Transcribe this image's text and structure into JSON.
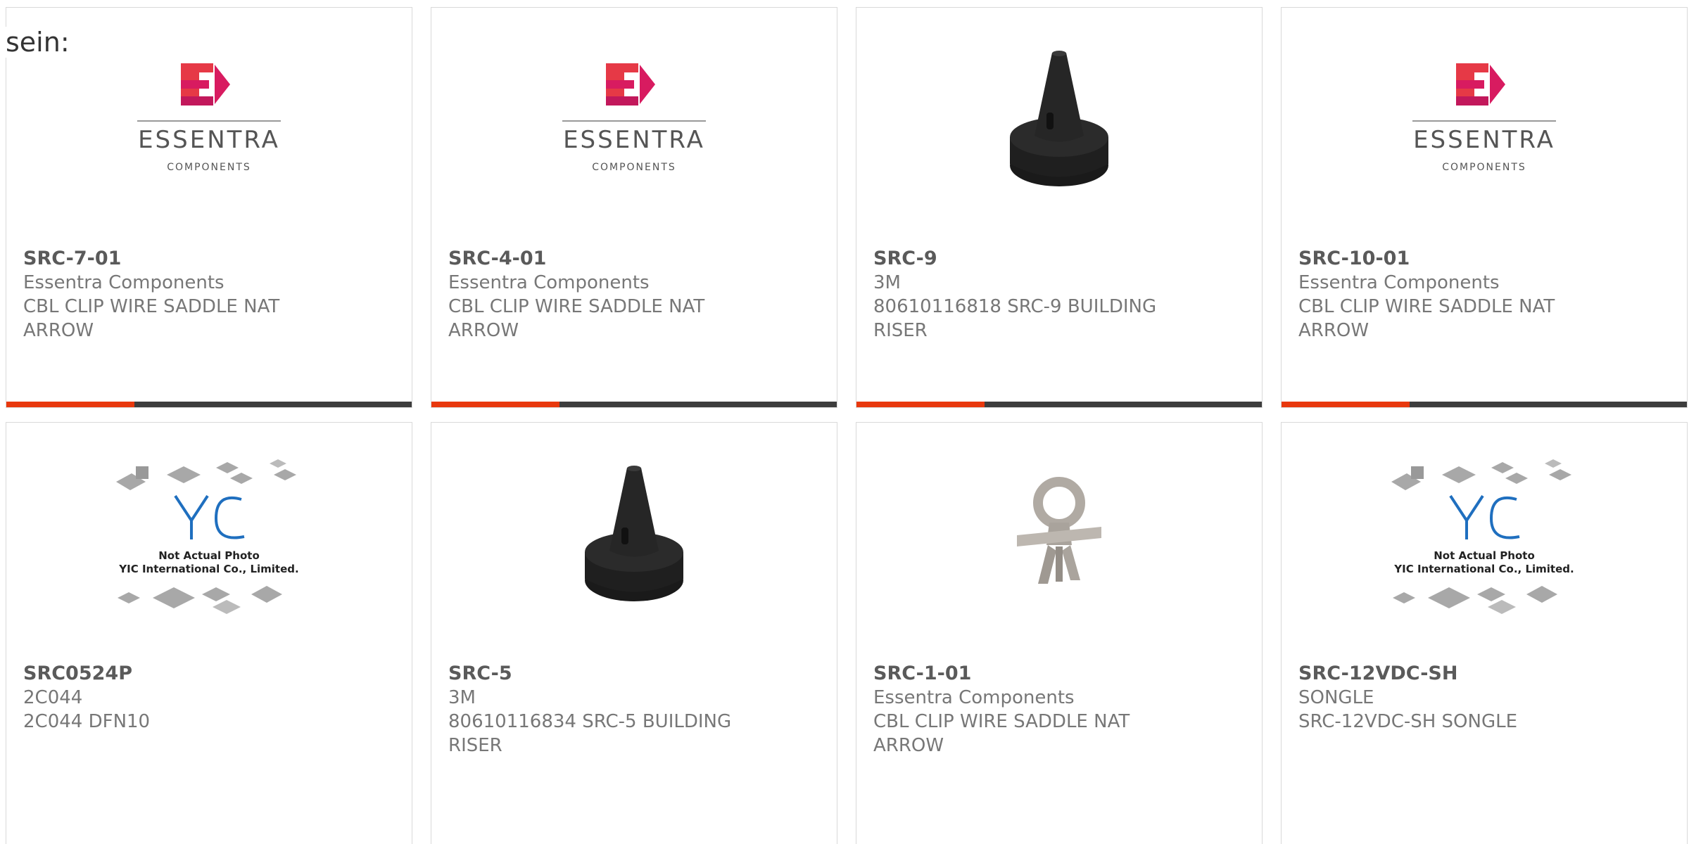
{
  "lead_text": "sein:",
  "colors": {
    "accent": "#e8380d",
    "bar": "#3d3d3d",
    "brand_red": "#e63946"
  },
  "cards": [
    {
      "part": "SRC-7-01",
      "line1": "Essentra Components",
      "line2": "CBL CLIP WIRE SADDLE NAT",
      "line3": "ARROW",
      "image": "essentra-logo",
      "logo_word": "ESSENTRA",
      "logo_sub": "COMPONENTS"
    },
    {
      "part": "SRC-4-01",
      "line1": "Essentra Components",
      "line2": "CBL CLIP WIRE SADDLE NAT",
      "line3": "ARROW",
      "image": "essentra-logo",
      "logo_word": "ESSENTRA",
      "logo_sub": "COMPONENTS"
    },
    {
      "part": "SRC-9",
      "line1": "3M",
      "line2": "80610116818 SRC-9 BUILDING",
      "line3": "RISER",
      "image": "black-riser-photo"
    },
    {
      "part": "SRC-10-01",
      "line1": "Essentra Components",
      "line2": "CBL CLIP WIRE SADDLE NAT",
      "line3": "ARROW",
      "image": "essentra-logo",
      "logo_word": "ESSENTRA",
      "logo_sub": "COMPONENTS"
    },
    {
      "part": "SRC0524P",
      "line1": "2C044",
      "line2": "2C044 DFN10",
      "line3": "",
      "image": "yic-placeholder",
      "ph_line1": "Not Actual Photo",
      "ph_line2": "YIC International Co., Limited."
    },
    {
      "part": "SRC-5",
      "line1": "3M",
      "line2": "80610116834 SRC-5 BUILDING",
      "line3": "RISER",
      "image": "black-riser-photo"
    },
    {
      "part": "SRC-1-01",
      "line1": "Essentra Components",
      "line2": "CBL CLIP WIRE SADDLE NAT",
      "line3": "ARROW",
      "image": "grey-clip-photo"
    },
    {
      "part": "SRC-12VDC-SH",
      "line1": "SONGLE",
      "line2": "SRC-12VDC-SH SONGLE",
      "line3": "",
      "image": "yic-placeholder",
      "ph_line1": "Not Actual Photo",
      "ph_line2": "YIC International Co., Limited."
    }
  ]
}
